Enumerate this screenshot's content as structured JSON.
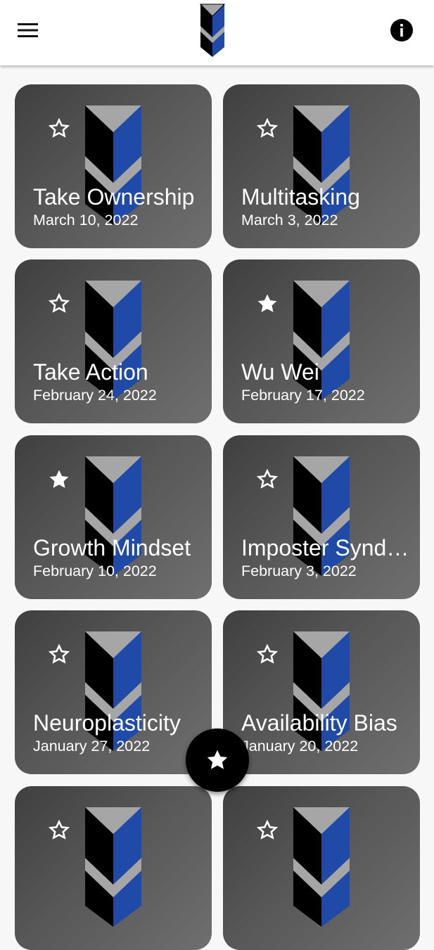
{
  "header": {
    "menu_icon": "menu-icon",
    "logo_icon": "chevron-logo-icon",
    "info_icon": "info-icon"
  },
  "colors": {
    "brand_blue": "#1f4aa8",
    "logo_gray": "#a6a6a6",
    "card_dark": "#3f3f3f",
    "card_light": "#6f6f6f",
    "fab": "#000000"
  },
  "cards": [
    {
      "title": "Take Ownership",
      "date": "March 10, 2022",
      "favorite": false
    },
    {
      "title": "Multitasking",
      "date": "March 3, 2022",
      "favorite": false
    },
    {
      "title": "Take Action",
      "date": "February 24, 2022",
      "favorite": false
    },
    {
      "title": "Wu Wei",
      "date": "February 17, 2022",
      "favorite": true
    },
    {
      "title": "Growth Mindset",
      "date": "February 10, 2022",
      "favorite": true
    },
    {
      "title": "Imposter Syndrome",
      "date": "February 3, 2022",
      "favorite": false
    },
    {
      "title": "Neuroplasticity",
      "date": "January 27, 2022",
      "favorite": false
    },
    {
      "title": "Availability Bias",
      "date": "January 20, 2022",
      "favorite": false
    },
    {
      "title": "",
      "date": "",
      "favorite": false
    },
    {
      "title": "",
      "date": "",
      "favorite": false
    }
  ],
  "fab": {
    "icon": "star-icon"
  }
}
